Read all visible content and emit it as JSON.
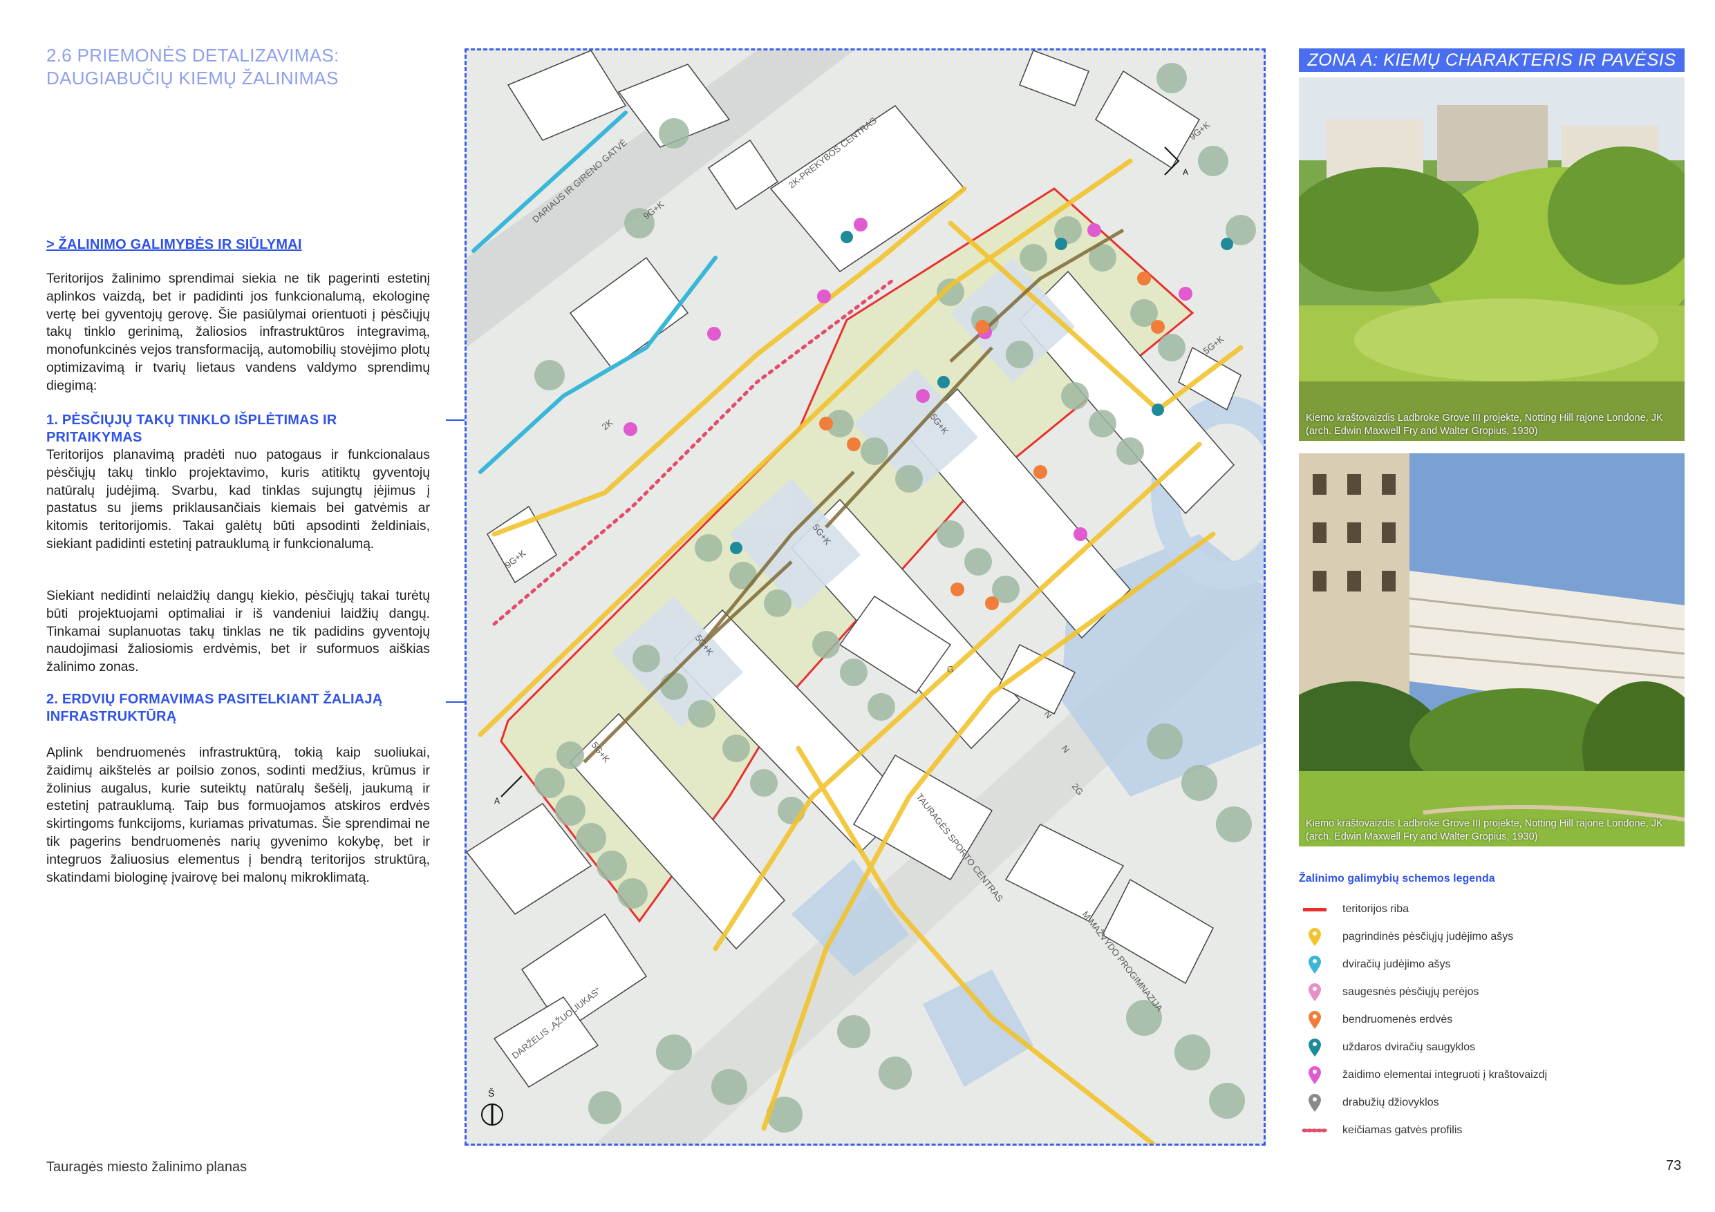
{
  "header": {
    "title_line1": "2.6 PRIEMONĖS DETALIZAVIMAS:",
    "title_line2": "DAUGIABUČIŲ KIEMŲ ŽALINIMAS"
  },
  "section": {
    "subheading": "> ŽALINIMO GALIMYBĖS IR SIŪLYMAI",
    "intro": "Teritorijos žalinimo sprendimai siekia ne tik pagerinti estetinį aplinkos vaizdą, bet ir padidinti jos funkcionalumą, ekologinę vertę bei gyventojų gerovę. Šie pasiūlymai orientuoti į pėsčiųjų takų tinklo gerinimą, žaliosios infrastruktūros integravimą, monofunkcinės vejos transformaciją, automobilių stovėjimo plotų optimizavimą ir tvarių lietaus vandens valdymo sprendimų diegimą:",
    "h1": "1. PĖSČIŲJŲ TAKŲ TINKLO IŠPLĖTIMAS IR PRITAIKYMAS",
    "p1": "Teritorijos planavimą pradėti nuo patogaus ir funkcionalaus pėsčiųjų takų tinklo projektavimo, kuris atitiktų gyventojų natūralų judėjimą. Svarbu, kad tinklas sujungtų įėjimus į pastatus su jiems priklausančiais kiemais bei gatvėmis ar kitomis teritorijomis. Takai galėtų būti apsodinti želdiniais, siekiant padidinti estetinį patrauklumą ir funkcionalumą.",
    "p2": "Siekiant nedidinti nelaidžių dangų kiekio, pėsčiųjų takai turėtų būti projektuojami optimaliai ir iš vandeniui laidžių dangų. Tinkamai suplanuotas takų tinklas ne tik padidins gyventojų naudojimasi žaliosiomis erdvėmis, bet ir suformuos aiškias žalinimo zonas.",
    "h2_line1": "2. ERDVIŲ FORMAVIMAS PASITELKIANT ŽALIAJĄ",
    "h2_line2": "INFRASTRUKTŪRĄ",
    "p3": "Aplink bendruomenės infrastruktūrą, tokią kaip suoliukai, žaidimų aikštelės ar poilsio zonos, sodinti medžius, krūmus ir žolinius augalus, kurie suteiktų natūralų šešėlį, jaukumą ir estetinį patrauklumą. Taip bus formuojamos atskiros erdvės skirtingoms funkcijoms, kuriamas privatumas. Šie sprendimai ne tik pagerins bendruomenės narių gyvenimo kokybę, bet ir integruos žaliuosius elementus į bendrą teritorijos struktūrą, skatindami biologinę įvairovę bei malonų mikroklimatą."
  },
  "footer": {
    "doc_name": "Tauragės miesto žalinimo planas",
    "page_number": "73"
  },
  "map": {
    "street_label": "DARIAUS IR GIRĖNO GATVĖ",
    "building_labels": [
      "2K-PREKYBOS CENTRAS",
      "9G+K",
      "5G+K",
      "5G+K",
      "5G+K",
      "5G+K",
      "9G+K",
      "9G+K",
      "2K",
      "G",
      "N",
      "N",
      "2G",
      "5G+K",
      "TAURAGĖS SPORTO CENTRAS",
      "M.MAŽVYDO PROGIMNAZIJA",
      "DARŽELIS „ĄŽUOLIUKAS“"
    ],
    "section_marker_a": "A",
    "north_label": "Š"
  },
  "right": {
    "zone_banner": "ZONA A: KIEMŲ CHARAKTERIS IR PAVĖSIS",
    "photo1_caption": "Kiemo kraštovaizdis Ladbroke Grove III projekte, Notting Hill rajone Londone, JK (arch. Edwin Maxwell Fry and Walter Gropius, 1930)",
    "photo2_caption": "Kiemo kraštovaizdis Ladbroke Grove III projekte, Notting Hill rajone Londone, JK (arch. Edwin Maxwell Fry and Walter Gropius, 1930)",
    "legend_title": "Žalinimo galimybių schemos legenda",
    "legend": [
      {
        "label": "teritorijos riba",
        "icon": "red-line",
        "color": "#e8302f"
      },
      {
        "label": "pagrindinės pėsčiųjų judėjimo ašys",
        "icon": "pedestrian-pin",
        "color": "#f2c32e"
      },
      {
        "label": "dviračių judėjimo ašys",
        "icon": "bicycle-pin",
        "color": "#3ab7d8"
      },
      {
        "label": "saugesnės pėsčiųjų perėjos",
        "icon": "crossing-pin",
        "color": "#e98fc6"
      },
      {
        "label": "bendruomenės erdvės",
        "icon": "community-pin",
        "color": "#f07d3a"
      },
      {
        "label": "uždaros dviračių saugyklos",
        "icon": "bike-storage-pin",
        "color": "#1f8a9a"
      },
      {
        "label": "žaidimo elementai integruoti į kraštovaizdį",
        "icon": "play-pin",
        "color": "#e05bd0"
      },
      {
        "label": "drabužių džiovyklos",
        "icon": "laundry-pin",
        "color": "#8a8a8a"
      },
      {
        "label": "keičiamas gatvės profilis",
        "icon": "dotted-line",
        "color": "#e34c6c"
      }
    ]
  }
}
